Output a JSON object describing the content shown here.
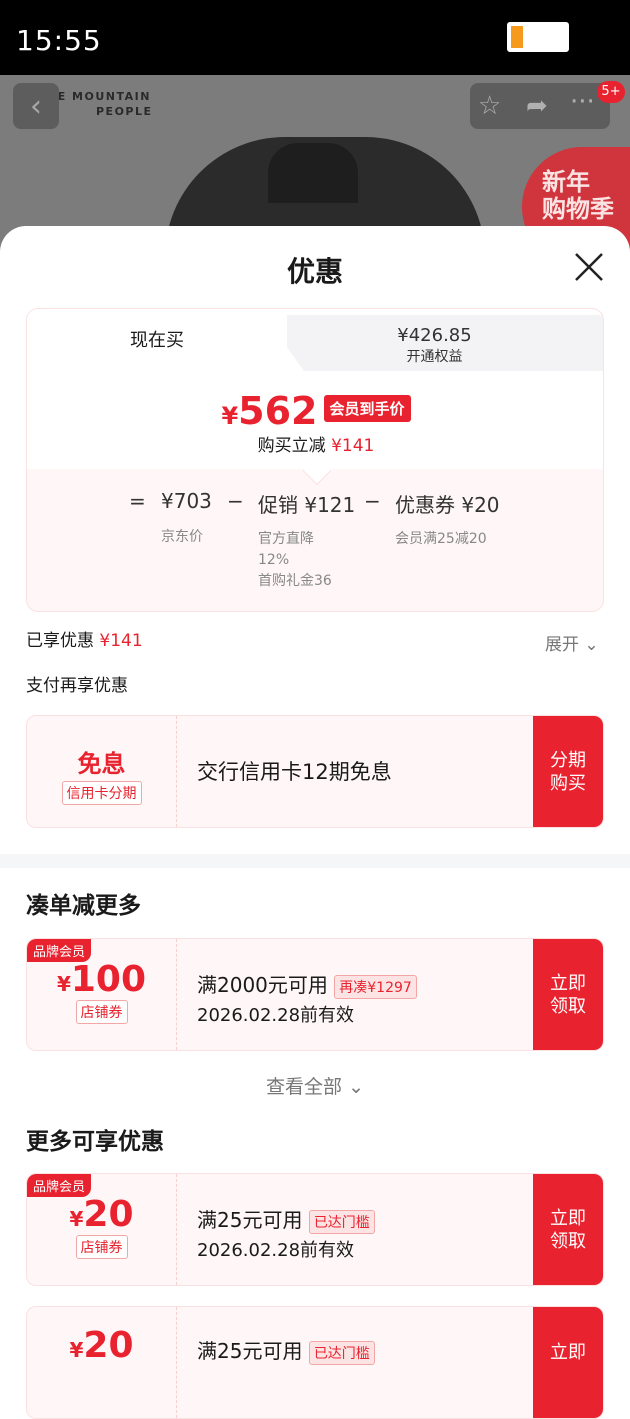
{
  "status_bar": {
    "time": "15:55"
  },
  "product": {
    "brand_line1": "THE MOUNTAIN",
    "brand_line2": "PEOPLE",
    "badge": "5+",
    "promo_line1": "新年",
    "promo_line2": "购物季"
  },
  "sheet": {
    "title": "优惠",
    "tabs": {
      "now": "现在买",
      "member_price": "¥426.85",
      "member_label": "开通权益"
    },
    "price": {
      "currency": "¥",
      "value": "562",
      "tag": "会员到手价",
      "reduce_label": "购买立减",
      "reduce_value": "¥141"
    },
    "breakdown": {
      "eq": "=",
      "minus": "−",
      "jd_price": "¥703",
      "jd_label": "京东价",
      "promo": "促销 ¥121",
      "promo_sub1": "官方直降",
      "promo_sub2": "12%",
      "promo_sub3": "首购礼金36",
      "coupon": "优惠券 ¥20",
      "coupon_sub": "会员满25减20"
    },
    "enjoyed_label": "已享优惠",
    "enjoyed_value": "¥141",
    "expand": "展开",
    "pay_more": "支付再享优惠",
    "installment": {
      "title": "免息",
      "tag": "信用卡分期",
      "desc": "交行信用卡12期免息",
      "button_l1": "分期",
      "button_l2": "购买"
    },
    "section1": "凑单减更多",
    "coupon1": {
      "member_tag": "品牌会员",
      "currency": "¥",
      "amount": "100",
      "type": "店铺券",
      "cond": "满2000元可用",
      "extra": "再凑¥1297",
      "expiry": "2026.02.28前有效",
      "button_l1": "立即",
      "button_l2": "领取"
    },
    "view_all": "查看全部",
    "section2": "更多可享优惠",
    "coupon2": {
      "member_tag": "品牌会员",
      "currency": "¥",
      "amount": "20",
      "type": "店铺券",
      "cond": "满25元可用",
      "extra": "已达门槛",
      "expiry": "2026.02.28前有效",
      "button_l1": "立即",
      "button_l2": "领取"
    },
    "coupon3": {
      "currency": "¥",
      "amount": "20",
      "cond": "满25元可用",
      "extra": "已达门槛",
      "button_l1": "立即"
    }
  },
  "colors": {
    "accent": "#e8232f",
    "battery": "#f59a1c"
  },
  "icons": [
    "back-icon",
    "star-icon",
    "share-icon",
    "more-icon",
    "close-icon",
    "chevron-down-icon"
  ]
}
